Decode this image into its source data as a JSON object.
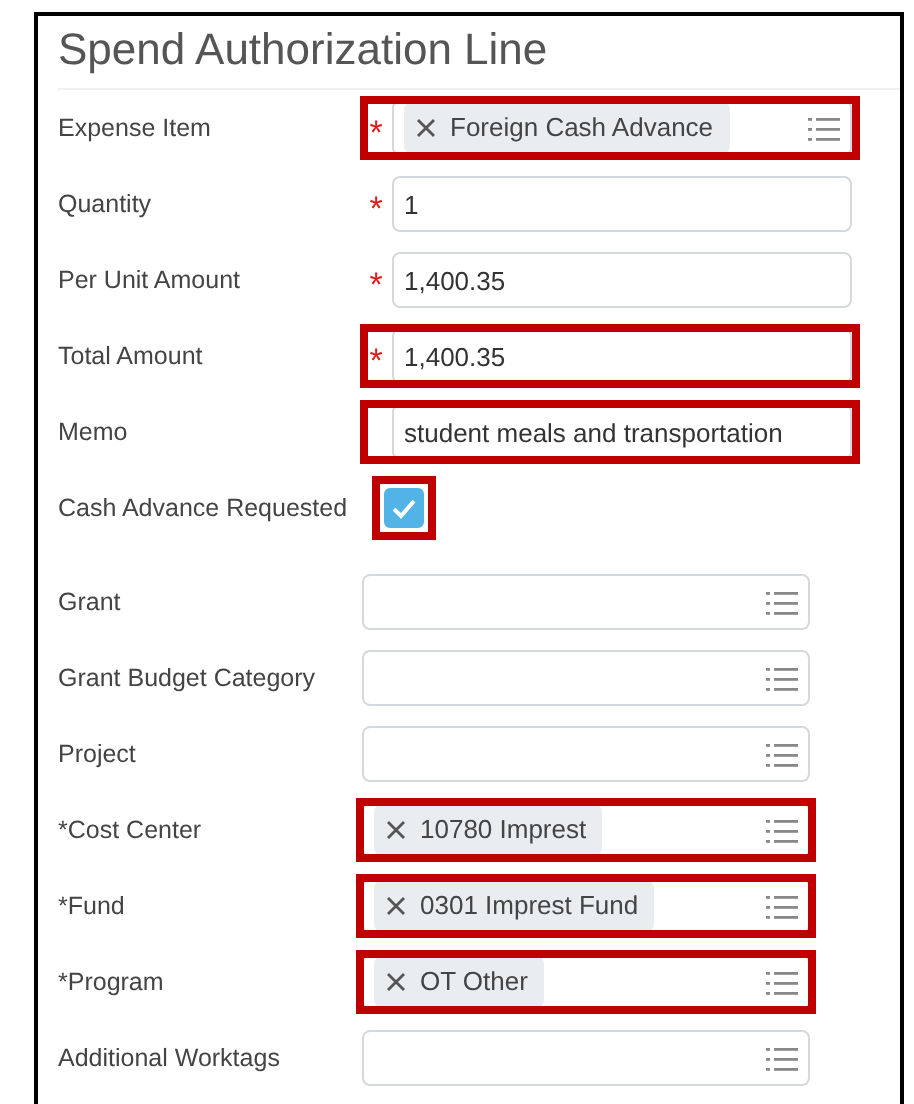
{
  "title": "Spend Authorization Line",
  "upper_fields": [
    {
      "label": "Expense Item",
      "kind": "prompt",
      "required_mark": "*",
      "highlighted": true,
      "value": "Foreign Cash Advance"
    },
    {
      "label": "Quantity",
      "kind": "text",
      "required_mark": "*",
      "highlighted": false,
      "value": "1"
    },
    {
      "label": "Per Unit Amount",
      "kind": "text",
      "required_mark": "*",
      "highlighted": false,
      "value": "1,400.35"
    },
    {
      "label": "Total Amount",
      "kind": "text",
      "required_mark": "*",
      "highlighted": true,
      "value": "1,400.35"
    },
    {
      "label": "Memo",
      "kind": "text",
      "highlighted": true,
      "value": "student meals and transportation"
    },
    {
      "label": "Cash Advance Requested",
      "kind": "checkbox",
      "highlighted": true,
      "checked": true
    }
  ],
  "worktag_fields": [
    {
      "label": "Grant",
      "highlighted": false
    },
    {
      "label": "Grant Budget Category",
      "highlighted": false
    },
    {
      "label": "Project",
      "highlighted": false
    },
    {
      "label": "*Cost Center",
      "highlighted": true,
      "value": "10780 Imprest"
    },
    {
      "label": "*Fund",
      "highlighted": true,
      "value": "0301 Imprest Fund"
    },
    {
      "label": "*Program",
      "highlighted": true,
      "value": "OT Other"
    },
    {
      "label": "Additional Worktags",
      "highlighted": false
    }
  ]
}
